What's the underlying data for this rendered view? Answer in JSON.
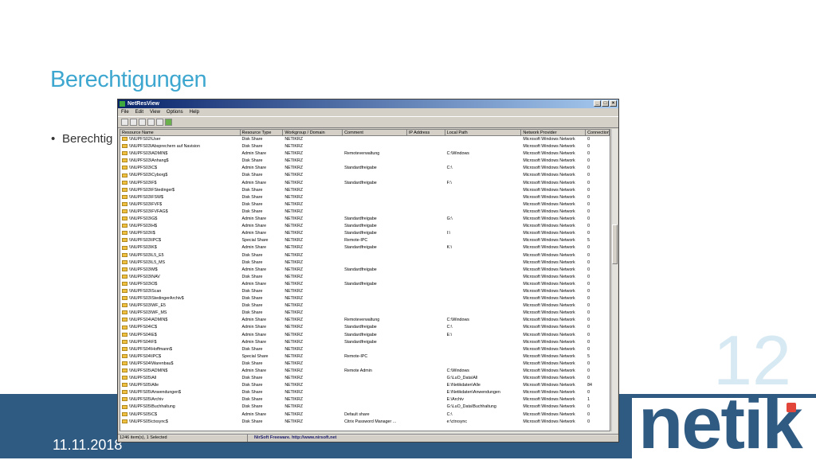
{
  "slide": {
    "title": "Berechtigungen",
    "bullet": "Berechtig",
    "date": "11.11.2018",
    "page_number": "12",
    "logo_text": "netik"
  },
  "colors": {
    "title": "#3ea7cf",
    "band": "#2f5b83",
    "logo": "#2f5b83",
    "logo_accent": "#e2463b",
    "page_number": "#d7e9f3"
  },
  "window": {
    "title": "NetResView",
    "menu": [
      "File",
      "Edit",
      "View",
      "Options",
      "Help"
    ],
    "toolbar_icons": [
      "save-icon",
      "properties-icon",
      "copy-icon",
      "html-report-icon",
      "refresh-icon",
      "exit-icon"
    ],
    "columns": [
      "Resource Name",
      "Resource Type",
      "Workgroup / Domain",
      "Comment",
      "IP Address",
      "Local Path",
      "Network Provider",
      "Connections"
    ],
    "rows": [
      [
        "\\\\NUPFS02\\User",
        "Disk Share",
        "NETIKRZ",
        "",
        "",
        "",
        "Microsoft Windows Network",
        "0"
      ],
      [
        "\\\\NUPFS03\\Absprechern auf Navision",
        "Disk Share",
        "NETIKRZ",
        "",
        "",
        "",
        "Microsoft Windows Network",
        "0"
      ],
      [
        "\\\\NUPFS03\\ADMIN$",
        "Admin Share",
        "NETIKRZ",
        "Remoteverwaltung",
        "",
        "C:\\Windows",
        "Microsoft Windows Network",
        "0"
      ],
      [
        "\\\\NUPFS03\\Anhang$",
        "Disk Share",
        "NETIKRZ",
        "",
        "",
        "",
        "Microsoft Windows Network",
        "0"
      ],
      [
        "\\\\NUPFS03\\C$",
        "Admin Share",
        "NETIKRZ",
        "Standardfreigabe",
        "",
        "C:\\",
        "Microsoft Windows Network",
        "0"
      ],
      [
        "\\\\NUPFS03\\Cyborg$",
        "Disk Share",
        "NETIKRZ",
        "",
        "",
        "",
        "Microsoft Windows Network",
        "0"
      ],
      [
        "\\\\NUPFS03\\F$",
        "Admin Share",
        "NETIKRZ",
        "Standardfreigabe",
        "",
        "F:\\",
        "Microsoft Windows Network",
        "0"
      ],
      [
        "\\\\NUPFS03\\FStedinger$",
        "Disk Share",
        "NETIKRZ",
        "",
        "",
        "",
        "Microsoft Windows Network",
        "0"
      ],
      [
        "\\\\NUPFS03\\FSW$",
        "Disk Share",
        "NETIKRZ",
        "",
        "",
        "",
        "Microsoft Windows Network",
        "0"
      ],
      [
        "\\\\NUPFS03\\FVF$",
        "Disk Share",
        "NETIKRZ",
        "",
        "",
        "",
        "Microsoft Windows Network",
        "0"
      ],
      [
        "\\\\NUPFS03\\FVFAG$",
        "Disk Share",
        "NETIKRZ",
        "",
        "",
        "",
        "Microsoft Windows Network",
        "0"
      ],
      [
        "\\\\NUPFS03\\G$",
        "Admin Share",
        "NETIKRZ",
        "Standardfreigabe",
        "",
        "G:\\",
        "Microsoft Windows Network",
        "0"
      ],
      [
        "\\\\NUPFS03\\H$",
        "Admin Share",
        "NETIKRZ",
        "Standardfreigabe",
        "",
        "",
        "Microsoft Windows Network",
        "0"
      ],
      [
        "\\\\NUPFS03\\I$",
        "Admin Share",
        "NETIKRZ",
        "Standardfreigabe",
        "",
        "I:\\",
        "Microsoft Windows Network",
        "0"
      ],
      [
        "\\\\NUPFS03\\IPC$",
        "Special Share",
        "NETIKRZ",
        "Remote-IPC",
        "",
        "",
        "Microsoft Windows Network",
        "5"
      ],
      [
        "\\\\NUPFS03\\K$",
        "Admin Share",
        "NETIKRZ",
        "Standardfreigabe",
        "",
        "K:\\",
        "Microsoft Windows Network",
        "0"
      ],
      [
        "\\\\NUPFS03\\L5_E5",
        "Disk Share",
        "NETIKRZ",
        "",
        "",
        "",
        "Microsoft Windows Network",
        "0"
      ],
      [
        "\\\\NUPFS03\\L5_MS",
        "Disk Share",
        "NETIKRZ",
        "",
        "",
        "",
        "Microsoft Windows Network",
        "0"
      ],
      [
        "\\\\NUPFS03\\M$",
        "Admin Share",
        "NETIKRZ",
        "Standardfreigabe",
        "",
        "",
        "Microsoft Windows Network",
        "0"
      ],
      [
        "\\\\NUPFS03\\NAV",
        "Disk Share",
        "NETIKRZ",
        "",
        "",
        "",
        "Microsoft Windows Network",
        "0"
      ],
      [
        "\\\\NUPFS03\\O$",
        "Admin Share",
        "NETIKRZ",
        "Standardfreigabe",
        "",
        "",
        "Microsoft Windows Network",
        "0"
      ],
      [
        "\\\\NUPFS03\\Scan",
        "Disk Share",
        "NETIKRZ",
        "",
        "",
        "",
        "Microsoft Windows Network",
        "0"
      ],
      [
        "\\\\NUPFS03\\StedingerArchiv$",
        "Disk Share",
        "NETIKRZ",
        "",
        "",
        "",
        "Microsoft Windows Network",
        "0"
      ],
      [
        "\\\\NUPFS03\\WF_E5",
        "Disk Share",
        "NETIKRZ",
        "",
        "",
        "",
        "Microsoft Windows Network",
        "0"
      ],
      [
        "\\\\NUPFS03\\WF_MS",
        "Disk Share",
        "NETIKRZ",
        "",
        "",
        "",
        "Microsoft Windows Network",
        "0"
      ],
      [
        "\\\\NUPFS04\\ADMIN$",
        "Admin Share",
        "NETIKRZ",
        "Remoteverwaltung",
        "",
        "C:\\Windows",
        "Microsoft Windows Network",
        "0"
      ],
      [
        "\\\\NUPFS04\\C$",
        "Admin Share",
        "NETIKRZ",
        "Standardfreigabe",
        "",
        "C:\\",
        "Microsoft Windows Network",
        "0"
      ],
      [
        "\\\\NUPFS04\\E$",
        "Admin Share",
        "NETIKRZ",
        "Standardfreigabe",
        "",
        "E:\\",
        "Microsoft Windows Network",
        "0"
      ],
      [
        "\\\\NUPFS04\\F$",
        "Admin Share",
        "NETIKRZ",
        "Standardfreigabe",
        "",
        "",
        "Microsoft Windows Network",
        "0"
      ],
      [
        "\\\\NUPFS04\\Hoffmann$",
        "Disk Share",
        "NETIKRZ",
        "",
        "",
        "",
        "Microsoft Windows Network",
        "0"
      ],
      [
        "\\\\NUPFS04\\IPC$",
        "Special Share",
        "NETIKRZ",
        "Remote-IPC",
        "",
        "",
        "Microsoft Windows Network",
        "5"
      ],
      [
        "\\\\NUPFS04\\Warenbau$",
        "Disk Share",
        "NETIKRZ",
        "",
        "",
        "",
        "Microsoft Windows Network",
        "0"
      ],
      [
        "\\\\NUPFS05\\ADMIN$",
        "Admin Share",
        "NETIKRZ",
        "Remote Admin",
        "",
        "C:\\Windows",
        "Microsoft Windows Network",
        "0"
      ],
      [
        "\\\\NUPFS05\\All",
        "Disk Share",
        "NETIKRZ",
        "",
        "",
        "G:\\LuO_Data\\All",
        "Microsoft Windows Network",
        "0"
      ],
      [
        "\\\\NUPFS05\\Alle",
        "Disk Share",
        "NETIKRZ",
        "",
        "",
        "E:\\Netikdaten\\Alle",
        "Microsoft Windows Network",
        "84"
      ],
      [
        "\\\\NUPFS05\\Anwendungen$",
        "Disk Share",
        "NETIKRZ",
        "",
        "",
        "E:\\Netikdaten\\Anwendungen",
        "Microsoft Windows Network",
        "0"
      ],
      [
        "\\\\NUPFS05\\Archiv",
        "Disk Share",
        "NETIKRZ",
        "",
        "",
        "E:\\Archiv",
        "Microsoft Windows Network",
        "1"
      ],
      [
        "\\\\NUPFS05\\Buchhaltung",
        "Disk Share",
        "NETIKRZ",
        "",
        "",
        "G:\\LuO_Data\\Buchhaltung",
        "Microsoft Windows Network",
        "0"
      ],
      [
        "\\\\NUPFS05\\C$",
        "Admin Share",
        "NETIKRZ",
        "Default share",
        "",
        "C:\\",
        "Microsoft Windows Network",
        "0"
      ],
      [
        "\\\\NUPFS05\\ctxsync$",
        "Disk Share",
        "NETIKRZ",
        "Citrix Password Manager ...",
        "",
        "e:\\ctrxsync",
        "Microsoft Windows Network",
        "0"
      ]
    ],
    "status_count": "1246 item(s), 1 Selected",
    "status_credit": "NirSoft Freeware.  http://www.nirsoft.net"
  }
}
